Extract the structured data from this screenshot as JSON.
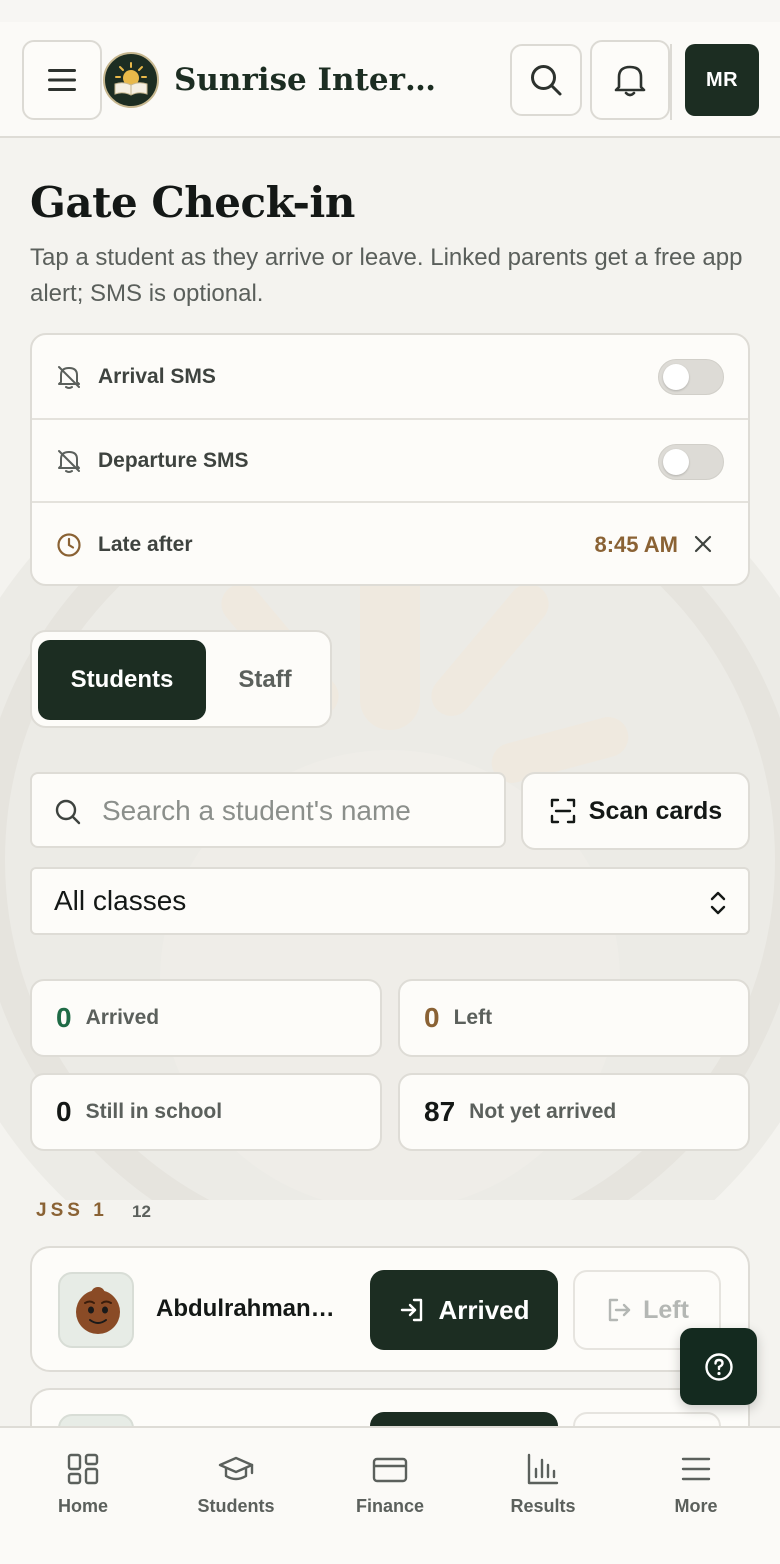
{
  "header": {
    "school_name": "Sunrise Interna…",
    "avatar_initials": "MR"
  },
  "page": {
    "title": "Gate Check-in",
    "subtitle": "Tap a student as they arrive or leave. Linked parents get a free app alert; SMS is optional."
  },
  "settings": {
    "arrival_sms_label": "Arrival SMS",
    "arrival_sms_on": false,
    "departure_sms_label": "Departure SMS",
    "departure_sms_on": false,
    "late_after_label": "Late after",
    "late_after_time": "8:45 AM"
  },
  "segments": {
    "students": "Students",
    "staff": "Staff",
    "active": "students"
  },
  "search": {
    "placeholder": "Search a student's name",
    "value": ""
  },
  "scan_button": "Scan cards",
  "class_filter": {
    "selected": "All classes"
  },
  "stats": {
    "arrived": {
      "count": "0",
      "label": "Arrived"
    },
    "left": {
      "count": "0",
      "label": "Left"
    },
    "still_in_school": {
      "count": "0",
      "label": "Still in school"
    },
    "not_yet_arrived": {
      "count": "87",
      "label": "Not yet arrived"
    }
  },
  "group": {
    "name": "JSS 1",
    "count": "12"
  },
  "students": [
    {
      "name": "Abdulrahman…",
      "arrived_label": "Arrived",
      "left_label": "Left"
    }
  ],
  "nav": {
    "items": [
      {
        "label": "Home"
      },
      {
        "label": "Students"
      },
      {
        "label": "Finance"
      },
      {
        "label": "Results"
      },
      {
        "label": "More"
      }
    ]
  },
  "colors": {
    "primary": "#1c2d22",
    "accent_brown": "#8a6234",
    "arrived_green": "#1f6b46",
    "background": "#f4f3ef"
  }
}
